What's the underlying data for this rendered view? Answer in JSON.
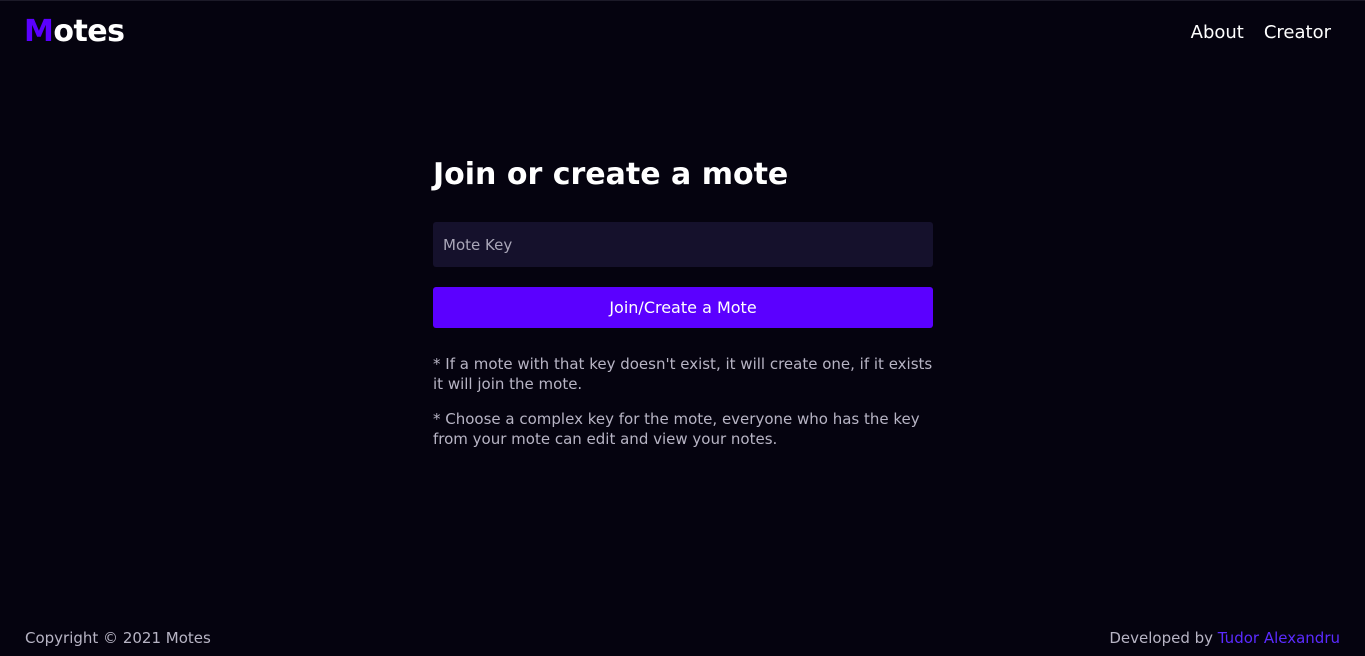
{
  "brand": {
    "first_letter": "M",
    "rest": "otes",
    "accent_color": "#5b00ff"
  },
  "nav": {
    "items": [
      {
        "label": "About"
      },
      {
        "label": "Creator"
      }
    ]
  },
  "main": {
    "title": "Join or create a mote",
    "input_placeholder": "Mote Key",
    "input_value": "",
    "button_label": "Join/Create a Mote",
    "notes": [
      "* If a mote with that key doesn't exist, it will create one, if it exists it will join the mote.",
      "* Choose a complex key for the mote, everyone who has the key from your mote can edit and view your notes."
    ]
  },
  "footer": {
    "copyright": "Copyright © 2021 Motes",
    "developed_by_prefix": "Developed by ",
    "developer_name": "Tudor Alexandru"
  },
  "colors": {
    "background": "#05030f",
    "input_background": "#15112c",
    "button": "#5b00ff",
    "muted_text": "#b7b4c4"
  }
}
